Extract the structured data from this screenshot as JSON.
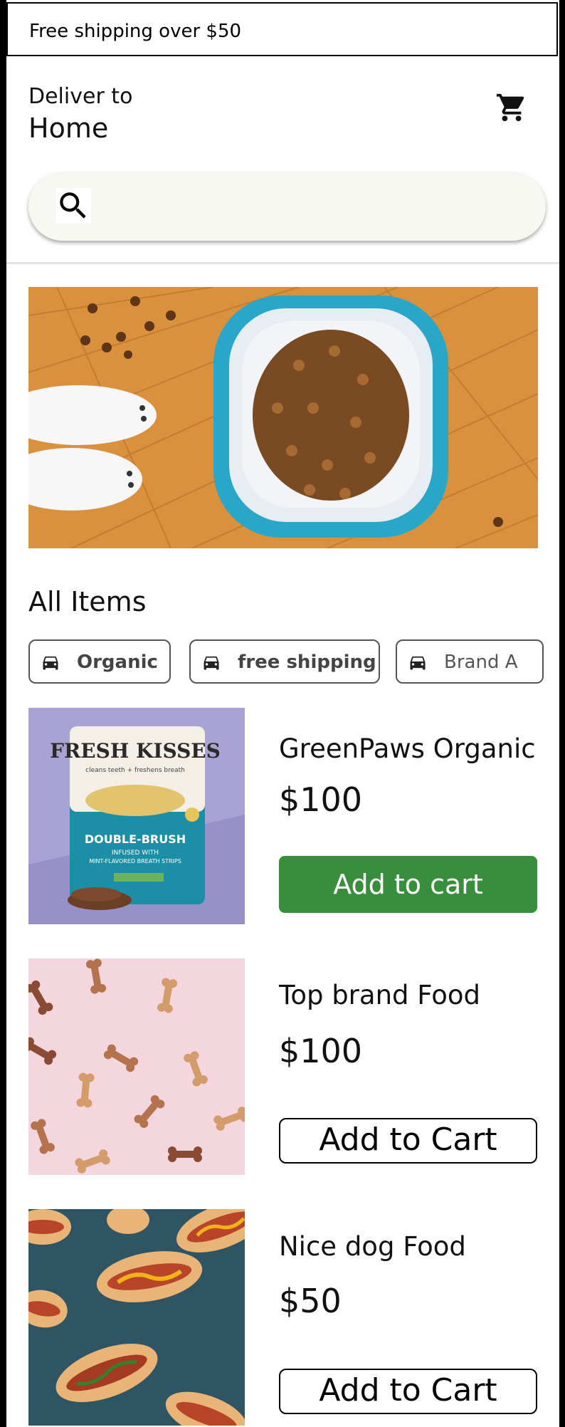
{
  "promo": {
    "text": "Free shipping over $50"
  },
  "header": {
    "deliver_label": "Deliver to",
    "deliver_value": "Home",
    "cart_icon": "shopping-cart-icon"
  },
  "search": {
    "placeholder": "",
    "icon": "search-icon"
  },
  "section": {
    "title": "All Items"
  },
  "filters": [
    {
      "label": "Organic",
      "icon": "car-icon"
    },
    {
      "label": "free shipping",
      "icon": "car-icon"
    },
    {
      "label": "Brand A",
      "icon": "car-icon"
    }
  ],
  "products": [
    {
      "name": "GreenPaws Organic",
      "price": "$100",
      "button": "Add to cart",
      "image_text": {
        "brand": "FRESH KISSES",
        "tagline": "cleans teeth + freshens breath",
        "line1": "DOUBLE-BRUSH",
        "line2": "INFUSED WITH",
        "line3": "MINT-FLAVORED BREATH STRIPS"
      }
    },
    {
      "name": "Top brand Food",
      "price": "$100",
      "button": "Add to Cart"
    },
    {
      "name": "Nice dog Food",
      "price": "$50",
      "button": "Add to Cart"
    }
  ],
  "colors": {
    "primary_button": "#388e3c",
    "search_bg": "#f8f8f3",
    "bowl": "#29a9c9"
  }
}
